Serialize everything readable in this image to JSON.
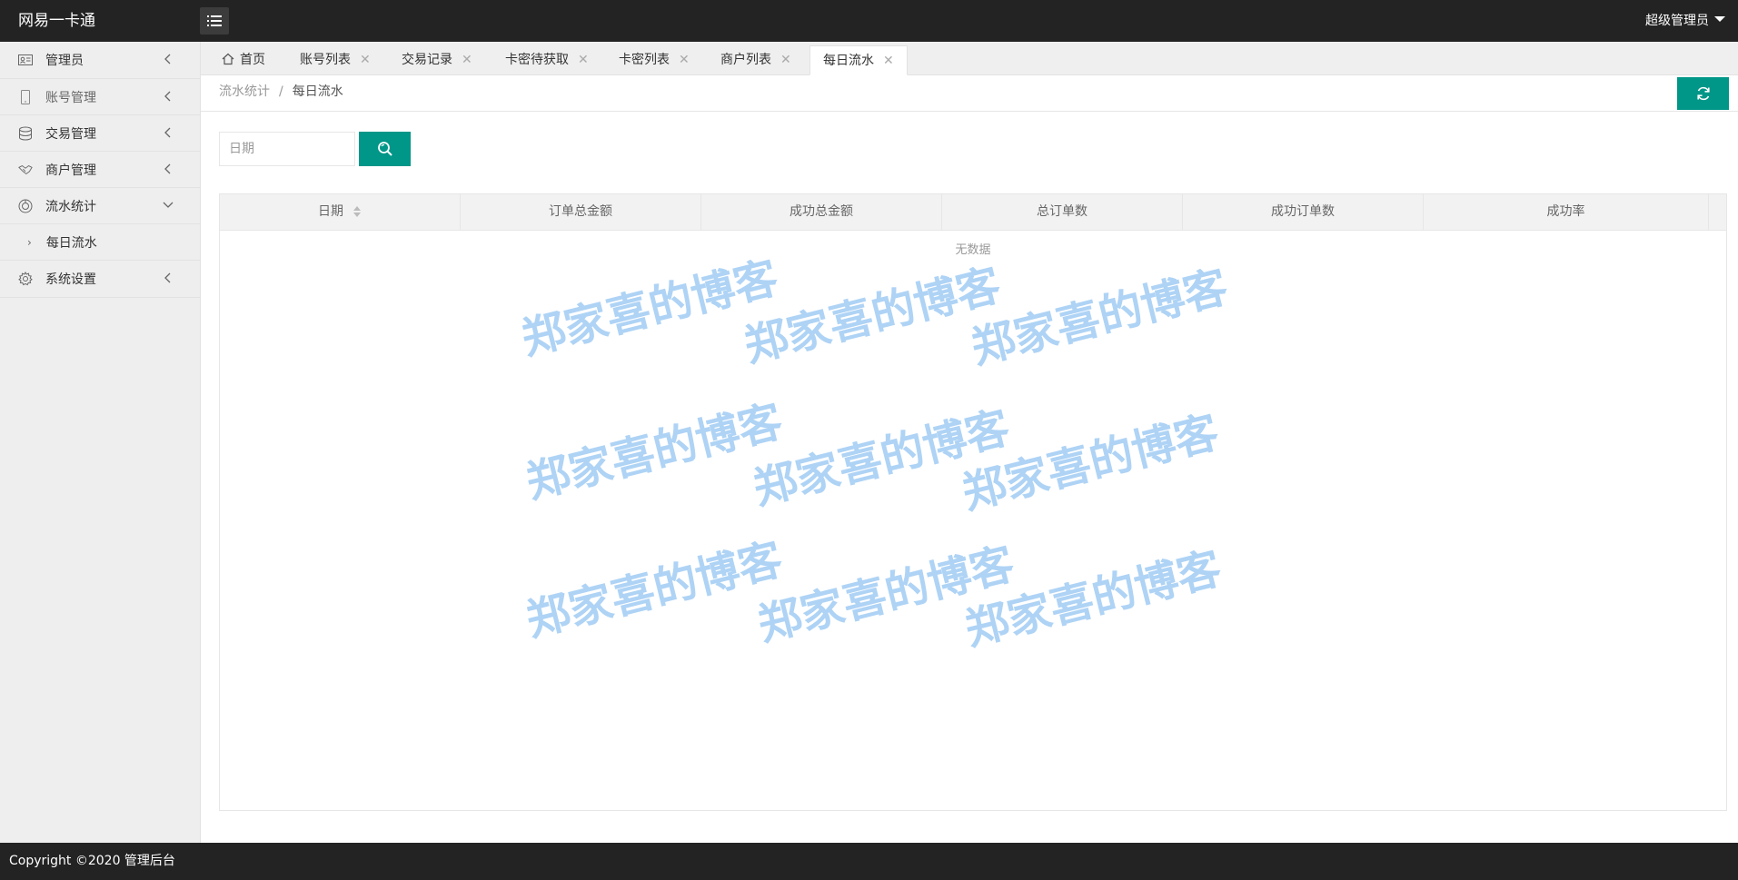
{
  "header": {
    "brand": "网易一卡通",
    "user": "超级管理员"
  },
  "sidebar": {
    "items": [
      {
        "label": "管理员",
        "icon": "id-card-icon"
      },
      {
        "label": "账号管理",
        "icon": "phone-icon"
      },
      {
        "label": "交易管理",
        "icon": "database-icon"
      },
      {
        "label": "商户管理",
        "icon": "handshake-icon"
      },
      {
        "label": "流水统计",
        "icon": "chart-icon"
      },
      {
        "label": "每日流水",
        "icon": "chevron-right-icon"
      },
      {
        "label": "系统设置",
        "icon": "gear-icon"
      }
    ]
  },
  "tabs": [
    {
      "label": "首页"
    },
    {
      "label": "账号列表"
    },
    {
      "label": "交易记录"
    },
    {
      "label": "卡密待获取"
    },
    {
      "label": "卡密列表"
    },
    {
      "label": "商户列表"
    },
    {
      "label": "每日流水"
    }
  ],
  "breadcrumb": {
    "parent": "流水统计",
    "separator": "/",
    "current": "每日流水"
  },
  "search": {
    "placeholder": "日期"
  },
  "table": {
    "columns": [
      "日期",
      "订单总金额",
      "成功总金额",
      "总订单数",
      "成功订单数",
      "成功率"
    ],
    "empty_text": "无数据"
  },
  "watermark": "郑家喜的博客",
  "footer": {
    "copyright": "Copyright ©2020 管理后台"
  },
  "colors": {
    "primary": "#009688",
    "header_bg": "#232323",
    "watermark": "#aed3f5"
  }
}
